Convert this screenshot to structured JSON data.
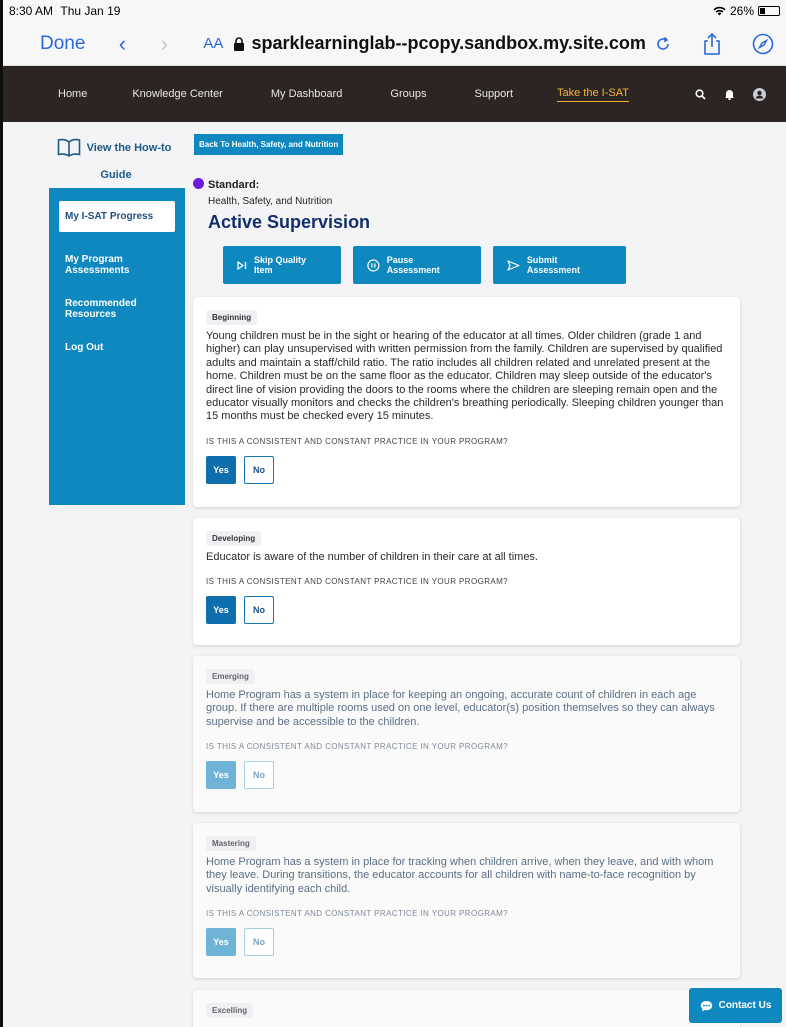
{
  "status_bar": {
    "time": "8:30 AM",
    "date": "Thu Jan 19",
    "battery": "26%",
    "battery_level": 0.26
  },
  "safari": {
    "done_label": "Done",
    "aa_label": "AA",
    "url": "sparklearninglab--pcopy.sandbox.my.site.com"
  },
  "nav": {
    "home": "Home",
    "knowledge_center": "Knowledge Center",
    "dashboard": "My Dashboard",
    "groups": "Groups",
    "support": "Support",
    "take_isat": "Take the I-SAT",
    "active_color": "#f2b335"
  },
  "howto": {
    "label_line1": "View the How-to",
    "label_line2": "Guide"
  },
  "sidebar": {
    "items": [
      {
        "label": "My I-SAT Progress"
      },
      {
        "label": "My Program Assessments"
      },
      {
        "label": "Recommended Resources"
      },
      {
        "label": "Log Out"
      }
    ]
  },
  "back_button": "Back To Health, Safety, and Nutrition",
  "standard": {
    "label": "Standard:",
    "category": "Health, Safety, and Nutrition",
    "title": "Active Supervision"
  },
  "actions": {
    "skip": "Skip Quality Item",
    "pause": "Pause Assessment",
    "submit": "Submit Assessment"
  },
  "question_text": "IS THIS A CONSISTENT AND CONSTANT PRACTICE IN YOUR PROGRAM?",
  "yes_label": "Yes",
  "no_label": "No",
  "cards": [
    {
      "level": "Beginning",
      "description": "Young children must be in the sight or hearing of the educator at all times. Older children (grade 1 and higher) can play unsupervised with written permission from the family. Children are supervised by qualified adults and maintain a staff/child ratio. The ratio includes all children related and unrelated present at the home. Children must be on the same floor as the educator. Children may sleep outside of the educator's direct line of vision providing the doors to the rooms where the children are sleeping remain open and the educator visually monitors and checks the children's breathing periodically. Sleeping children younger than 15 months must be checked every 15 minutes."
    },
    {
      "level": "Developing",
      "description": "Educator is aware of the number of children in their care at all times."
    },
    {
      "level": "Emerging",
      "description": "Home Program has a system in place for keeping an ongoing, accurate count of children in each age group. If there are multiple rooms used on one level, educator(s) position themselves so they can always supervise and be accessible to the children."
    },
    {
      "level": "Mastering",
      "description": "Home Program has a system in place for tracking when children arrive, when they leave, and with whom they leave. During transitions, the educator accounts for all children with name-to-face recognition by visually identifying each child."
    },
    {
      "level": "Excelling",
      "description": ""
    }
  ],
  "contact_label": "Contact Us",
  "colors": {
    "brand_blue": "#0f87bf",
    "nav_dark": "#2d2424",
    "title_navy": "#132f6b",
    "standard_dot": "#6c1bd8"
  }
}
